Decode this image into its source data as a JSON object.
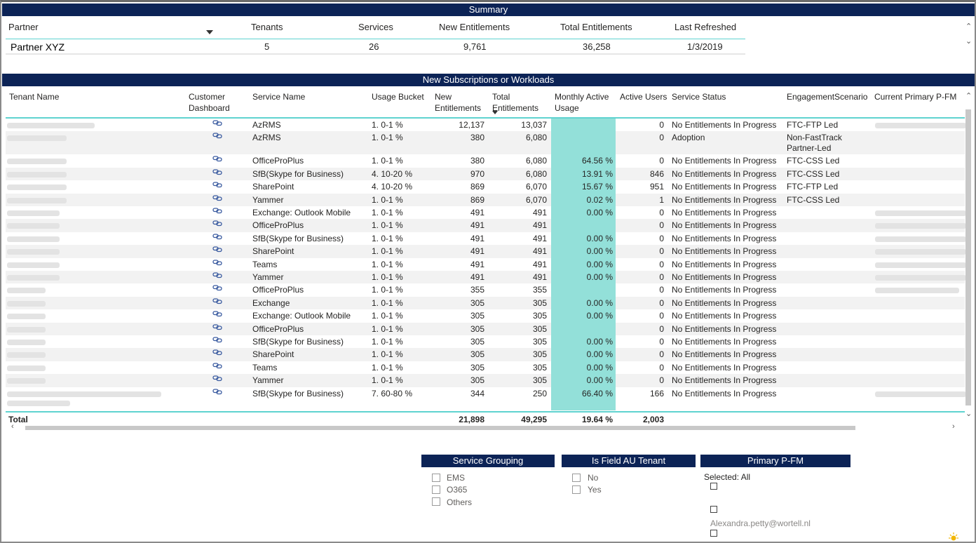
{
  "summary": {
    "title": "Summary",
    "headers": [
      "Partner",
      "Tenants",
      "Services",
      "New Entitlements",
      "Total Entitlements",
      "Last Refreshed"
    ],
    "values": [
      "Partner XYZ",
      "5",
      "26",
      "9,761",
      "36,258",
      "1/3/2019"
    ]
  },
  "table": {
    "title": "New Subscriptions or Workloads",
    "headers": {
      "tenant": "Tenant Name",
      "dashboard1": "Customer",
      "dashboard2": "Dashboard",
      "service": "Service Name",
      "bucket": "Usage Bucket",
      "newent1": "New",
      "newent2": "Entitlements",
      "totent1": "Total",
      "totent2": "Entitlements",
      "mau1": "Monthly Active",
      "mau2": "Usage",
      "active": "Active Users",
      "status": "Service Status",
      "scenario": "EngagementScenario",
      "pfm": "Current Primary P-FM"
    },
    "rows": [
      {
        "service": "AzRMS",
        "bucket": "1. 0-1 %",
        "newent": "12,137",
        "totent": "13,037",
        "mau": "",
        "active": "0",
        "status": "No Entitlements In Progress",
        "scenario": "FTC-FTP Led"
      },
      {
        "service": "AzRMS",
        "bucket": "1. 0-1 %",
        "newent": "380",
        "totent": "6,080",
        "mau": "",
        "active": "0",
        "status": "Adoption",
        "scenario": "Non-FastTrack",
        "scenario2": "Partner-Led"
      },
      {
        "service": "OfficeProPlus",
        "bucket": "1. 0-1 %",
        "newent": "380",
        "totent": "6,080",
        "mau": "64.56 %",
        "active": "0",
        "status": "No Entitlements In Progress",
        "scenario": "FTC-CSS Led"
      },
      {
        "service": "SfB(Skype for Business)",
        "bucket": "4. 10-20 %",
        "newent": "970",
        "totent": "6,080",
        "mau": "13.91 %",
        "active": "846",
        "status": "No Entitlements In Progress",
        "scenario": "FTC-CSS Led"
      },
      {
        "service": "SharePoint",
        "bucket": "4. 10-20 %",
        "newent": "869",
        "totent": "6,070",
        "mau": "15.67 %",
        "active": "951",
        "status": "No Entitlements In Progress",
        "scenario": "FTC-FTP Led"
      },
      {
        "service": "Yammer",
        "bucket": "1. 0-1 %",
        "newent": "869",
        "totent": "6,070",
        "mau": "0.02 %",
        "active": "1",
        "status": "No Entitlements In Progress",
        "scenario": "FTC-CSS Led"
      },
      {
        "service": "Exchange: Outlook Mobile",
        "bucket": "1. 0-1 %",
        "newent": "491",
        "totent": "491",
        "mau": "0.00 %",
        "active": "0",
        "status": "No Entitlements In Progress",
        "scenario": ""
      },
      {
        "service": "OfficeProPlus",
        "bucket": "1. 0-1 %",
        "newent": "491",
        "totent": "491",
        "mau": "",
        "active": "0",
        "status": "No Entitlements In Progress",
        "scenario": ""
      },
      {
        "service": "SfB(Skype for Business)",
        "bucket": "1. 0-1 %",
        "newent": "491",
        "totent": "491",
        "mau": "0.00 %",
        "active": "0",
        "status": "No Entitlements In Progress",
        "scenario": ""
      },
      {
        "service": "SharePoint",
        "bucket": "1. 0-1 %",
        "newent": "491",
        "totent": "491",
        "mau": "0.00 %",
        "active": "0",
        "status": "No Entitlements In Progress",
        "scenario": ""
      },
      {
        "service": "Teams",
        "bucket": "1. 0-1 %",
        "newent": "491",
        "totent": "491",
        "mau": "0.00 %",
        "active": "0",
        "status": "No Entitlements In Progress",
        "scenario": ""
      },
      {
        "service": "Yammer",
        "bucket": "1. 0-1 %",
        "newent": "491",
        "totent": "491",
        "mau": "0.00 %",
        "active": "0",
        "status": "No Entitlements In Progress",
        "scenario": ""
      },
      {
        "service": "OfficeProPlus",
        "bucket": "1. 0-1 %",
        "newent": "355",
        "totent": "355",
        "mau": "",
        "active": "0",
        "status": "No Entitlements In Progress",
        "scenario": ""
      },
      {
        "service": "Exchange",
        "bucket": "1. 0-1 %",
        "newent": "305",
        "totent": "305",
        "mau": "0.00 %",
        "active": "0",
        "status": "No Entitlements In Progress",
        "scenario": ""
      },
      {
        "service": "Exchange: Outlook Mobile",
        "bucket": "1. 0-1 %",
        "newent": "305",
        "totent": "305",
        "mau": "0.00 %",
        "active": "0",
        "status": "No Entitlements In Progress",
        "scenario": ""
      },
      {
        "service": "OfficeProPlus",
        "bucket": "1. 0-1 %",
        "newent": "305",
        "totent": "305",
        "mau": "",
        "active": "0",
        "status": "No Entitlements In Progress",
        "scenario": ""
      },
      {
        "service": "SfB(Skype for Business)",
        "bucket": "1. 0-1 %",
        "newent": "305",
        "totent": "305",
        "mau": "0.00 %",
        "active": "0",
        "status": "No Entitlements In Progress",
        "scenario": ""
      },
      {
        "service": "SharePoint",
        "bucket": "1. 0-1 %",
        "newent": "305",
        "totent": "305",
        "mau": "0.00 %",
        "active": "0",
        "status": "No Entitlements In Progress",
        "scenario": ""
      },
      {
        "service": "Teams",
        "bucket": "1. 0-1 %",
        "newent": "305",
        "totent": "305",
        "mau": "0.00 %",
        "active": "0",
        "status": "No Entitlements In Progress",
        "scenario": ""
      },
      {
        "service": "Yammer",
        "bucket": "1. 0-1 %",
        "newent": "305",
        "totent": "305",
        "mau": "0.00 %",
        "active": "0",
        "status": "No Entitlements In Progress",
        "scenario": ""
      },
      {
        "service": "SfB(Skype for Business)",
        "bucket": "7. 60-80 %",
        "newent": "344",
        "totent": "250",
        "mau": "66.40 %",
        "active": "166",
        "status": "No Entitlements In Progress",
        "scenario": ""
      }
    ],
    "total": {
      "label": "Total",
      "newent": "21,898",
      "totent": "49,295",
      "mau": "19.64 %",
      "active": "2,003"
    }
  },
  "slicers": {
    "service_grouping": {
      "title": "Service Grouping",
      "options": [
        "EMS",
        "O365",
        "Others"
      ]
    },
    "field_au": {
      "title": "Is Field AU Tenant",
      "options": [
        "No",
        "Yes"
      ]
    },
    "primary_pfm": {
      "title": "Primary P-FM",
      "selected": "Selected: All",
      "email": "Alexandra.petty@wortell.nl"
    }
  },
  "colors": {
    "banner": "#0c2356",
    "accent": "#5fd3d0",
    "mau_fill": "#93e0d9"
  },
  "icons": [
    "link-icon",
    "sort-desc-icon",
    "scroll-up-icon",
    "scroll-down-icon",
    "scroll-left-icon",
    "scroll-right-icon",
    "sun-icon"
  ]
}
